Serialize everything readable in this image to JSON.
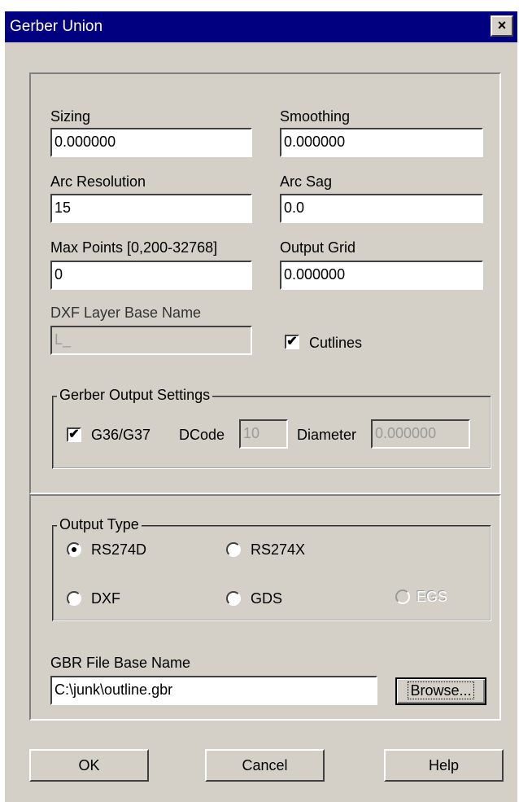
{
  "window": {
    "title": "Gerber Union",
    "close_glyph": "×"
  },
  "fields": {
    "sizing": {
      "label": "Sizing",
      "value": "0.000000"
    },
    "smoothing": {
      "label": "Smoothing",
      "value": "0.000000"
    },
    "arc_resolution": {
      "label": "Arc Resolution",
      "value": "15"
    },
    "arc_sag": {
      "label": "Arc Sag",
      "value": "0.0"
    },
    "max_points": {
      "label": "Max Points [0,200-32768]",
      "value": "0"
    },
    "output_grid": {
      "label": "Output Grid",
      "value": "0.000000"
    },
    "dxf_layer_base_name": {
      "label": "DXF Layer Base Name",
      "value": "L_"
    }
  },
  "cutlines": {
    "label": "Cutlines",
    "checked": true
  },
  "gerber_output_settings": {
    "title": "Gerber Output Settings",
    "g36_g37": {
      "label": "G36/G37",
      "checked": true
    },
    "dcode": {
      "label": "DCode",
      "value": "10"
    },
    "diameter": {
      "label": "Diameter",
      "value": "0.000000"
    }
  },
  "output_type": {
    "title": "Output Type",
    "options": [
      {
        "label": "RS274D",
        "selected": true,
        "enabled": true
      },
      {
        "label": "RS274X",
        "selected": false,
        "enabled": true
      },
      {
        "label": "DXF",
        "selected": false,
        "enabled": true
      },
      {
        "label": "GDS",
        "selected": false,
        "enabled": true
      },
      {
        "label": "EGS",
        "selected": false,
        "enabled": false
      }
    ]
  },
  "gbr_file": {
    "label": "GBR File Base Name",
    "value": "C:\\junk\\outline.gbr",
    "browse_label": "Browse..."
  },
  "buttons": {
    "ok": "OK",
    "cancel": "Cancel",
    "help": "Help"
  },
  "check_glyph": "✔"
}
